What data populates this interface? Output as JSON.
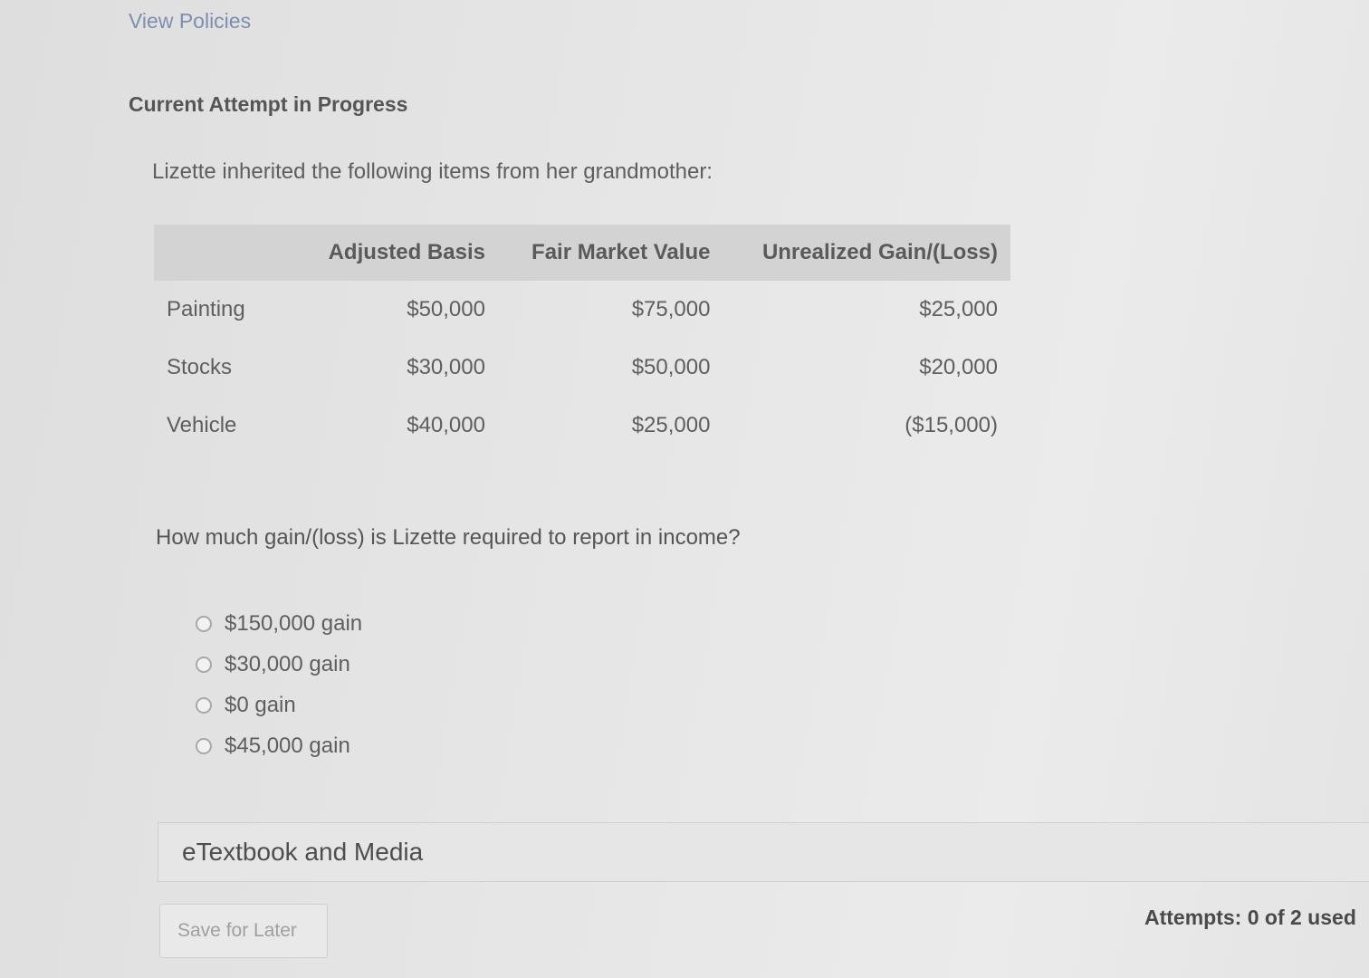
{
  "header": {
    "view_policies": "View Policies",
    "attempt_heading": "Current Attempt in Progress"
  },
  "question": {
    "intro": "Lizette inherited the following items from her grandmother:",
    "table": {
      "headers": [
        "",
        "Adjusted Basis",
        "Fair Market Value",
        "Unrealized Gain/(Loss)"
      ],
      "rows": [
        [
          "Painting",
          "$50,000",
          "$75,000",
          "$25,000"
        ],
        [
          "Stocks",
          "$30,000",
          "$50,000",
          "$20,000"
        ],
        [
          "Vehicle",
          "$40,000",
          "$25,000",
          "($15,000)"
        ]
      ]
    },
    "prompt": "How much gain/(loss) is Lizette required to report in income?",
    "options": [
      "$150,000 gain",
      "$30,000 gain",
      "$0 gain",
      "$45,000 gain"
    ]
  },
  "footer": {
    "etextbook_label": "eTextbook and Media",
    "save_label": "Save for Later",
    "attempts_text": "Attempts: 0 of 2 used"
  }
}
